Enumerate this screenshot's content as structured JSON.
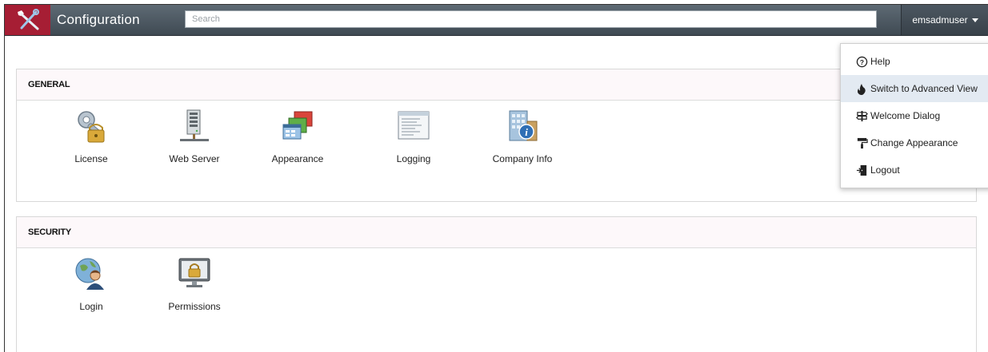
{
  "header": {
    "app_title": "Configuration",
    "search_placeholder": "Search",
    "user_name": "emsadmuser",
    "brand_color": "#a61e34"
  },
  "user_menu": {
    "items": [
      {
        "label": "Help",
        "icon": "help-circle-icon"
      },
      {
        "label": "Switch to Advanced View",
        "icon": "flame-icon"
      },
      {
        "label": "Welcome Dialog",
        "icon": "signpost-icon"
      },
      {
        "label": "Change Appearance",
        "icon": "paint-roller-icon"
      },
      {
        "label": "Logout",
        "icon": "logout-door-icon"
      }
    ],
    "highlighted_index": 1
  },
  "sections": [
    {
      "title": "GENERAL",
      "items": [
        {
          "label": "License",
          "icon": "key-lock-icon"
        },
        {
          "label": "Web Server",
          "icon": "server-icon"
        },
        {
          "label": "Appearance",
          "icon": "windows-icon"
        },
        {
          "label": "Logging",
          "icon": "log-document-icon"
        },
        {
          "label": "Company Info",
          "icon": "building-info-icon"
        }
      ]
    },
    {
      "title": "SECURITY",
      "items": [
        {
          "label": "Login",
          "icon": "user-globe-icon"
        },
        {
          "label": "Permissions",
          "icon": "monitor-lock-icon"
        }
      ]
    }
  ]
}
